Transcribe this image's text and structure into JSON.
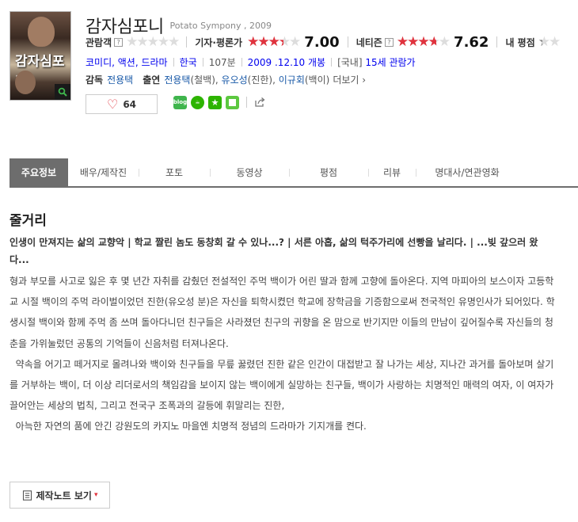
{
  "movie": {
    "title_ko": "감자심포니",
    "title_en": "Potato Sympony , 2009",
    "poster_title": "감자심포니",
    "zoom_icon": "magnifier-icon"
  },
  "ratings": {
    "audience": {
      "label": "관람객",
      "help": "?",
      "stars_fraction": 0.0
    },
    "critics": {
      "label": "기자·평론가",
      "stars_fraction": 0.7,
      "score": "7.00"
    },
    "netizen": {
      "label": "네티즌",
      "help": "?",
      "stars_fraction": 0.762,
      "score": "7.62"
    },
    "mine": {
      "label": "내 평점",
      "stars_fraction": 0.2
    }
  },
  "meta": {
    "genres": "코미디, 액션, 드라마",
    "country": "한국",
    "runtime": "107분",
    "release": "2009 .12.10 개봉",
    "grade_tag": "[국내]",
    "grade": "15세 관람가"
  },
  "credits": {
    "director_label": "감독",
    "director": "전용택",
    "cast_label": "출연",
    "cast": [
      {
        "name": "전용택",
        "role": "(철백)"
      },
      {
        "name": "유오성",
        "role": "(진한)"
      },
      {
        "name": "이규회",
        "role": "(백이)"
      }
    ],
    "more": "더보기 ›"
  },
  "like": {
    "count": "64"
  },
  "share": {
    "blog": "blog",
    "external_icon": "share-external-icon"
  },
  "tabs": [
    "주요정보",
    "배우/제작진",
    "포토",
    "동영상",
    "평점",
    "리뷰",
    "명대사/연관영화"
  ],
  "synopsis": {
    "heading": "줄거리",
    "tagline": "인생이 만져지는 삶의 교향악 | 학교 짤린 놈도 동창회 갈 수 있나...? | 서른 아홉, 삶의 턱주가리에 선빵을 날리다. | ...빚 갚으러 왔다...",
    "paragraphs": [
      "형과 부모를 사고로 잃은 후 몇 년간 자취를 감췄던 전설적인 주먹 백이가 어린 딸과 함께 고향에 돌아온다. 지역 마피아의 보스이자 고등학교 시절 백이의 주먹 라이벌이었던 진한(유오성 분)은 자신을 퇴학시켰던 학교에 장학금을 기증함으로써 전국적인 유명인사가 되어있다. 학생시절 백이와 함께 주먹 좀 쓰며 돌아다니던 친구들은 사라졌던 친구의 귀향을 온 맘으로 반기지만 이들의 만남이 깊어질수록 자신들의 청춘을 가위눌렀던 공통의 기억들이 신음처럼 터져나온다.",
      "  약속을 어기고 떼거지로 몰려나와 백이와 친구들을 무릎 꿇렸던 진한 같은 인간이 대접받고 잘 나가는 세상, 지나간 과거를 돌아보며 살기를 거부하는 백이, 더 이상 리더로서의 책임감을 보이지 않는 백이에게 실망하는 친구들, 백이가 사랑하는 치명적인 매력의 여자, 이 여자가 끌어안는 세상의 법칙, 그리고 전국구 조폭과의 갈등에 휘말리는 진한,",
      "  아늑한 자연의 품에 안긴 강원도의 카지노 마을엔 치명적 정념의 드라마가 기지개를 켠다."
    ],
    "note_button": "제작노트 보기",
    "note_caret": "▾"
  },
  "colors": {
    "accent": "#e0333e",
    "link": "#1a5aa8",
    "tab_active": "#6d6d6d"
  }
}
